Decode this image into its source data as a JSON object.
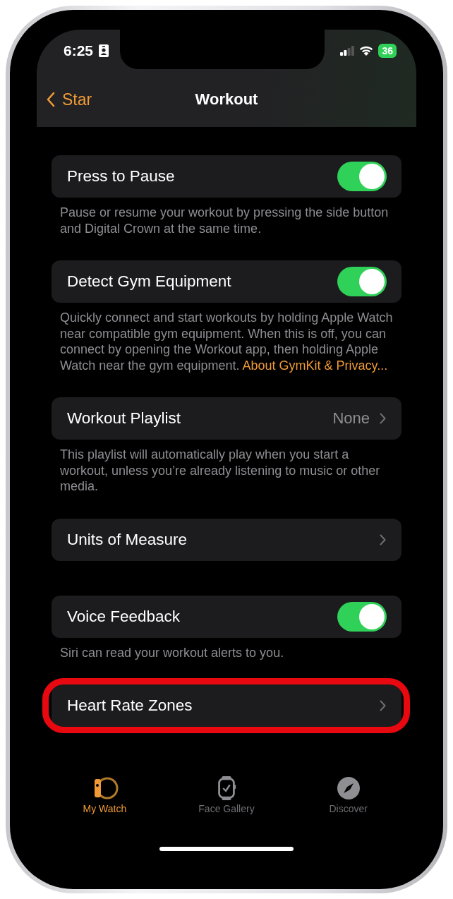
{
  "status_bar": {
    "time": "6:25",
    "battery": "36"
  },
  "nav_bar": {
    "back": "Star",
    "title": "Workout"
  },
  "sections": [
    {
      "rows": [
        {
          "kind": "toggle",
          "label": "Press to Pause",
          "on": true,
          "highlighted": false
        }
      ],
      "footer": "Pause or resume your workout by pressing the side button and Digital Crown at the same time."
    },
    {
      "rows": [
        {
          "kind": "toggle",
          "label": "Detect Gym Equipment",
          "on": true,
          "highlighted": false
        }
      ],
      "footer": "Quickly connect and start workouts by holding Apple Watch near compatible gym equipment. When this is off, you can connect by opening the Workout app, then holding Apple Watch near the gym equipment.",
      "footer_link": "About GymKit & Privacy..."
    },
    {
      "rows": [
        {
          "kind": "disclosure",
          "label": "Workout Playlist",
          "value": "None",
          "highlighted": false
        }
      ],
      "footer": "This playlist will automatically play when you start a workout, unless you’re already listening to music or other media."
    },
    {
      "rows": [
        {
          "kind": "disclosure",
          "label": "Units of Measure",
          "highlighted": false
        }
      ]
    },
    {
      "rows": [
        {
          "kind": "toggle",
          "label": "Voice Feedback",
          "on": true,
          "highlighted": false
        }
      ],
      "footer": "Siri can read your workout alerts to you."
    },
    {
      "rows": [
        {
          "kind": "disclosure",
          "label": "Heart Rate Zones",
          "highlighted": true
        }
      ]
    }
  ],
  "tab_bar": [
    {
      "label": "My Watch",
      "kind": "watch-side",
      "selected": true
    },
    {
      "label": "Face Gallery",
      "kind": "watch-face",
      "selected": false
    },
    {
      "label": "Discover",
      "kind": "compass",
      "selected": false
    }
  ]
}
